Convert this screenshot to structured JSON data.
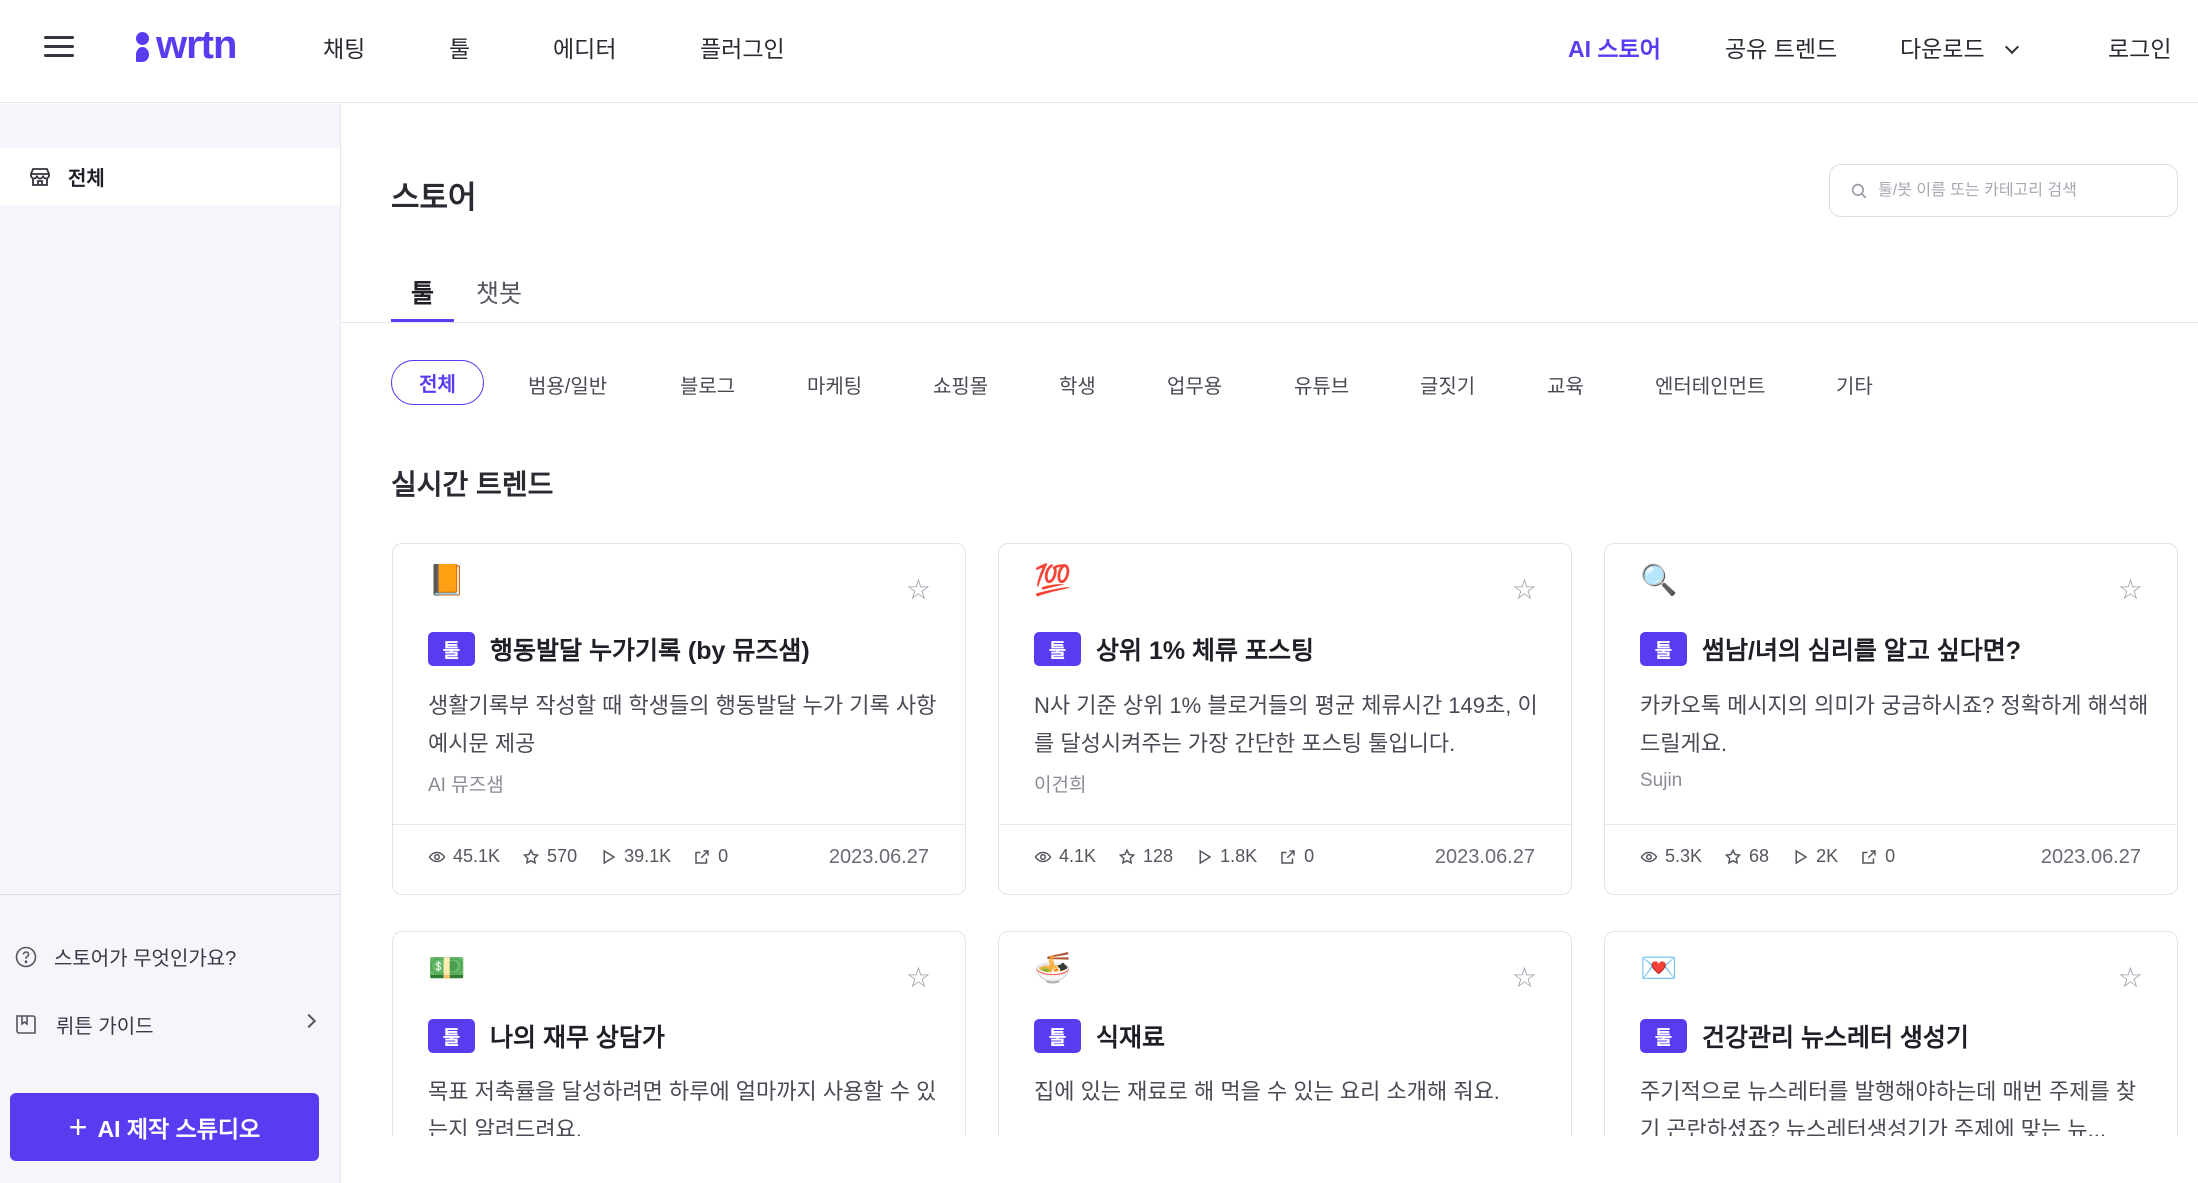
{
  "header": {
    "logo": "wrtn",
    "nav": [
      "채팅",
      "툴",
      "에디터",
      "플러그인"
    ],
    "right_nav": [
      "AI 스토어",
      "공유 트렌드",
      "다운로드"
    ],
    "login": "로그인",
    "accent_color": "#5a3cf0"
  },
  "sidebar": {
    "all_label": "전체",
    "help_label": "스토어가 무엇인가요?",
    "guide_label": "뤼튼 가이드",
    "studio_label": "AI 제작 스튜디오"
  },
  "main": {
    "title": "스토어",
    "search_placeholder": "툴/봇 이름 또는 카테고리 검색",
    "tabs": [
      "툴",
      "챗봇"
    ],
    "categories": [
      "전체",
      "범용/일반",
      "블로그",
      "마케팅",
      "쇼핑몰",
      "학생",
      "업무용",
      "유튜브",
      "글짓기",
      "교육",
      "엔터테인먼트",
      "기타"
    ],
    "section_title": "실시간 트렌드"
  },
  "cards": [
    {
      "emoji": "📙",
      "badge": "툴",
      "title": "행동발달 누가기록 (by 뮤즈샘)",
      "desc": "생활기록부 작성할 때 학생들의 행동발달 누가 기록 사항 예시문 제공",
      "author": "AI 뮤즈샘",
      "views": "45.1K",
      "stars": "570",
      "plays": "39.1K",
      "shares": "0",
      "date": "2023.06.27"
    },
    {
      "emoji": "💯",
      "badge": "툴",
      "title": "상위 1% 체류 포스팅",
      "desc": "N사 기준 상위 1% 블로거들의 평균 체류시간 149초, 이를 달성시켜주는 가장 간단한 포스팅 툴입니다.",
      "author": "이건희",
      "views": "4.1K",
      "stars": "128",
      "plays": "1.8K",
      "shares": "0",
      "date": "2023.06.27"
    },
    {
      "emoji": "🔍",
      "badge": "툴",
      "title": "썸남/녀의 심리를 알고 싶다면?",
      "desc": "카카오톡 메시지의 의미가 궁금하시죠? 정확하게 해석해 드릴게요.",
      "author": "Sujin",
      "views": "5.3K",
      "stars": "68",
      "plays": "2K",
      "shares": "0",
      "date": "2023.06.27"
    },
    {
      "emoji": "💵",
      "badge": "툴",
      "title": "나의 재무 상담가",
      "desc": "목표 저축률을 달성하려면 하루에 얼마까지 사용할 수 있는지 알려드려요."
    },
    {
      "emoji": "🍜",
      "badge": "툴",
      "title": "식재료",
      "desc": "집에 있는 재료로 해 먹을 수 있는 요리 소개해 줘요."
    },
    {
      "emoji": "💌",
      "badge": "툴",
      "title": "건강관리 뉴스레터 생성기",
      "desc": "주기적으로 뉴스레터를 발행해야하는데 매번 주제를 찾기 곤란하셨죠? 뉴스레터생성기가 주제에 맞는 뉴..."
    }
  ]
}
